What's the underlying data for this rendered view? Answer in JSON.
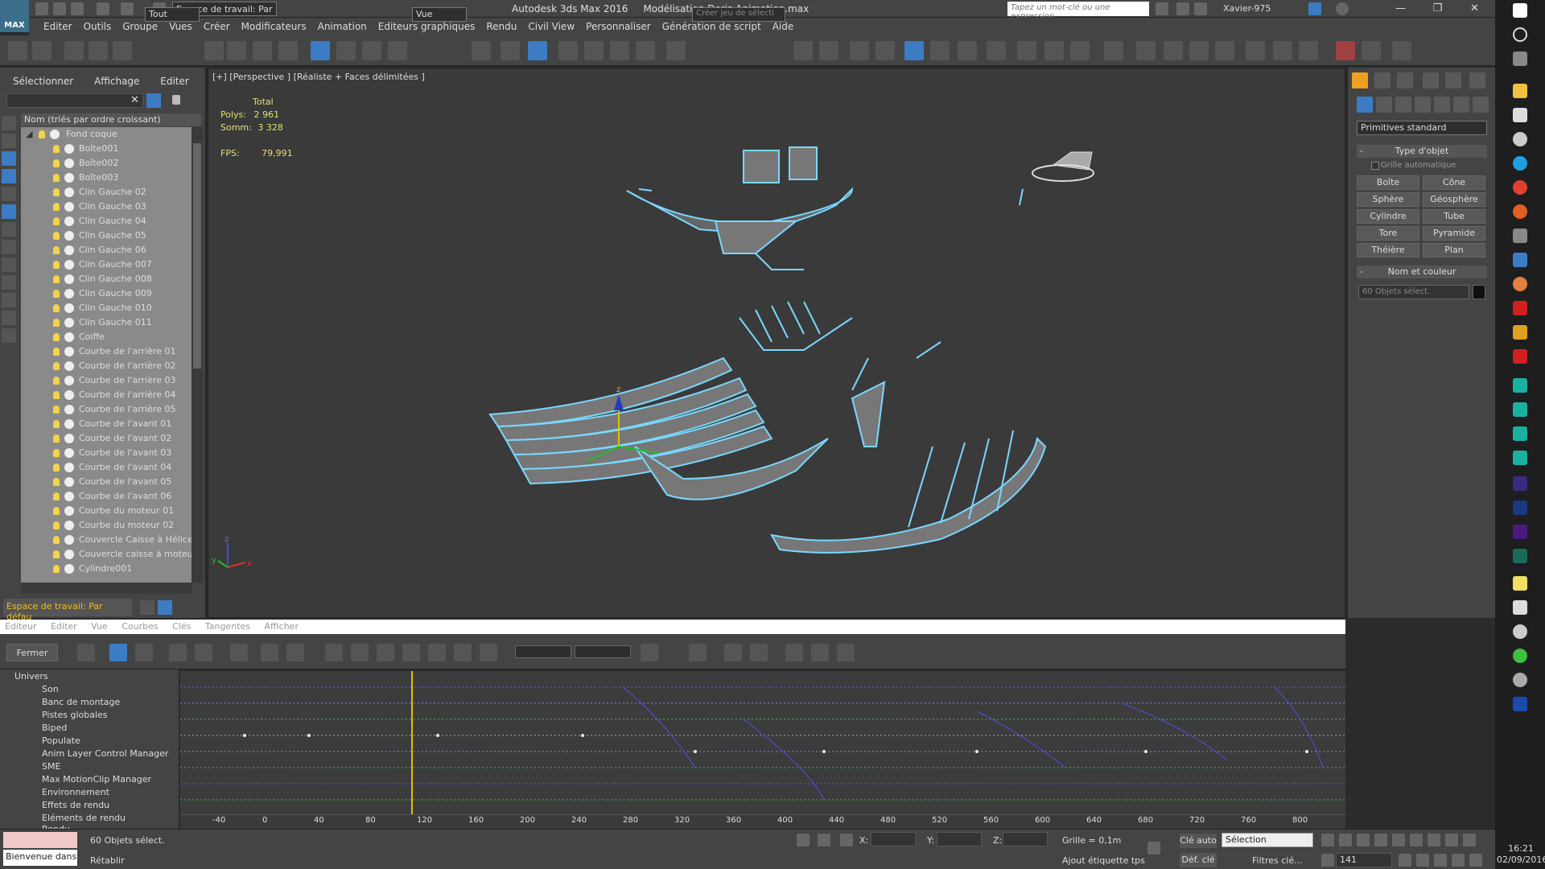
{
  "window": {
    "app_title": "Autodesk 3ds Max 2016",
    "file_title": "Modélisation Doris Animation.max",
    "workspace": "Espace de travail: Par",
    "search_placeholder": "Tapez un mot-clé ou une expression",
    "user": "Xavier-975",
    "logo_label": "MAX",
    "minimize": "—",
    "restore": "❐",
    "close": "✕"
  },
  "menu": [
    "Editer",
    "Outils",
    "Groupe",
    "Vues",
    "Créer",
    "Modificateurs",
    "Animation",
    "Editeurs graphiques",
    "Rendu",
    "Civil View",
    "Personnaliser",
    "Génération de script",
    "Aide"
  ],
  "toolbar": {
    "filter_value": "Tout",
    "refcoord_value": "Vue",
    "selection_set_placeholder": "Créer jeu de sélecti"
  },
  "explorer": {
    "menu": [
      "Sélectionner",
      "Affichage",
      "Editer"
    ],
    "column_header": "Nom (triés par ordre croissant)",
    "root": "Fond coque",
    "items": [
      "Boîte001",
      "Boîte002",
      "Boîte003",
      "Clin Gauche 02",
      "Clin Gauche 03",
      "Clin Gauche 04",
      "Clin Gauche 05",
      "Clin Gauche 06",
      "Clin Gauche 007",
      "Clin Gauche 008",
      "Clin Gauche 009",
      "Clin Gauche 010",
      "Clin Gauche 011",
      "Coiffe",
      "Courbe de l'arrière 01",
      "Courbe de l'arrière 02",
      "Courbe de l'arrière 03",
      "Courbe de l'arrière 04",
      "Courbe de l'arrière 05",
      "Courbe de l'avant 01",
      "Courbe de l'avant 02",
      "Courbe de l'avant 03",
      "Courbe de l'avant 04",
      "Courbe de l'avant 05",
      "Courbe de l'avant 06",
      "Courbe du moteur 01",
      "Courbe du moteur 02",
      "Couvercle Caisse à Hélice",
      "Couvercle caisse à moteur",
      "Cylindre001"
    ],
    "workspace_bar": "Espace de travail: Par défau"
  },
  "viewport": {
    "label": "[+] [Perspective ] [Réaliste + Faces délimitées ]",
    "stats_header": "Total",
    "polys_label": "Polys:",
    "polys_value": "2 961",
    "verts_label": "Somm:",
    "verts_value": "3 328",
    "fps_label": "FPS:",
    "fps_value": "79,991",
    "gizmo_z": "z",
    "axis_z": "z",
    "axis_y": "y",
    "axis_x": "x"
  },
  "command_panel": {
    "category": "Primitives standard",
    "object_type_title": "Type d'objet",
    "autogrid": "Grille automatique",
    "buttons": [
      "Boîte",
      "Cône",
      "Sphère",
      "Géosphère",
      "Cylindre",
      "Tube",
      "Tore",
      "Pyramide",
      "Théière",
      "Plan"
    ],
    "name_color_title": "Nom et couleur",
    "name_value": "60 Objets sélect.",
    "collapse": "-"
  },
  "curve_editor": {
    "menu": [
      "Editeur",
      "Editer",
      "Vue",
      "Courbes",
      "Clés",
      "Tangentes",
      "Afficher"
    ],
    "close_label": "Fermer",
    "zero_label": "0",
    "tree": [
      "Univers",
      "Son",
      "Banc de montage",
      "Pistes globales",
      "Biped",
      "Populate",
      "Anim Layer Control Manager",
      "SME",
      "Max MotionClip Manager",
      "Environnement",
      "Effets de rendu",
      "Eléments de rendu",
      "Rendu"
    ],
    "ruler": [
      "-40",
      "0",
      "40",
      "80",
      "120",
      "160",
      "200",
      "240",
      "280",
      "320",
      "360",
      "400",
      "440",
      "480",
      "520",
      "560",
      "600",
      "640",
      "680",
      "720",
      "760",
      "800"
    ]
  },
  "status": {
    "script_text": "Bienvenue dans",
    "selection": "60 Objets sélect.",
    "undo": "Rétablir",
    "x_label": "X:",
    "y_label": "Y:",
    "z_label": "Z:",
    "grid": "Grille = 0,1m",
    "add_time_tag": "Ajout étiquette tps",
    "auto_key": "Clé auto",
    "set_key": "Déf. clé",
    "selection_dd": "Sélection",
    "key_filters": "Filtres clé...",
    "frame": "141"
  },
  "clock": {
    "time": "16:21",
    "date": "02/09/2016"
  },
  "colors": {
    "accent_blue": "#3b7cc4",
    "wire_cyan": "#7ad8ff",
    "stats_yellow": "#e0e070"
  }
}
